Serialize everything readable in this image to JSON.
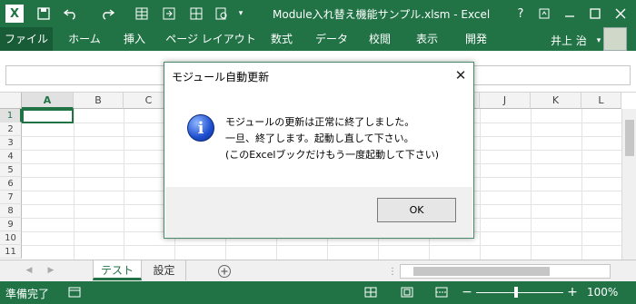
{
  "title_bar": {
    "app_icon_letter": "X",
    "title": "Module入れ替え機能サンプル.xlsm - Excel",
    "icons": [
      "excel-logo-icon",
      "save-icon",
      "undo-icon",
      "redo-icon",
      "table-icon",
      "import-icon",
      "grid-icon",
      "print-preview-icon",
      "customize-qat-icon",
      "help-icon",
      "ribbon-display-icon",
      "minimize-icon",
      "maximize-icon",
      "close-icon"
    ]
  },
  "ribbon_tabs": [
    "ファイル",
    "ホーム",
    "挿入",
    "ページ レイアウト",
    "数式",
    "データ",
    "校閲",
    "表示",
    "開発"
  ],
  "user_name": "井上 治",
  "columns": [
    "A",
    "B",
    "C",
    "D",
    "E",
    "F",
    "G",
    "H",
    "I",
    "J",
    "K",
    "L"
  ],
  "rows": [
    "1",
    "2",
    "3",
    "4",
    "5",
    "6",
    "7",
    "8",
    "9",
    "10",
    "11"
  ],
  "sheets": [
    "テスト",
    "設定"
  ],
  "status": {
    "text": "準備完了",
    "zoom": "100%"
  },
  "dialog": {
    "title": "モジュール自動更新",
    "icon": "information-icon",
    "lines": [
      "モジュールの更新は正常に終了しました。",
      "一旦、終了します。起動し直して下さい。",
      "(このExcelブックだけもう一度起動して下さい)"
    ],
    "ok_label": "OK"
  },
  "colors": {
    "excel_green": "#217346",
    "dark_green": "#185c37",
    "dialog_footer": "#f0f0f0"
  }
}
